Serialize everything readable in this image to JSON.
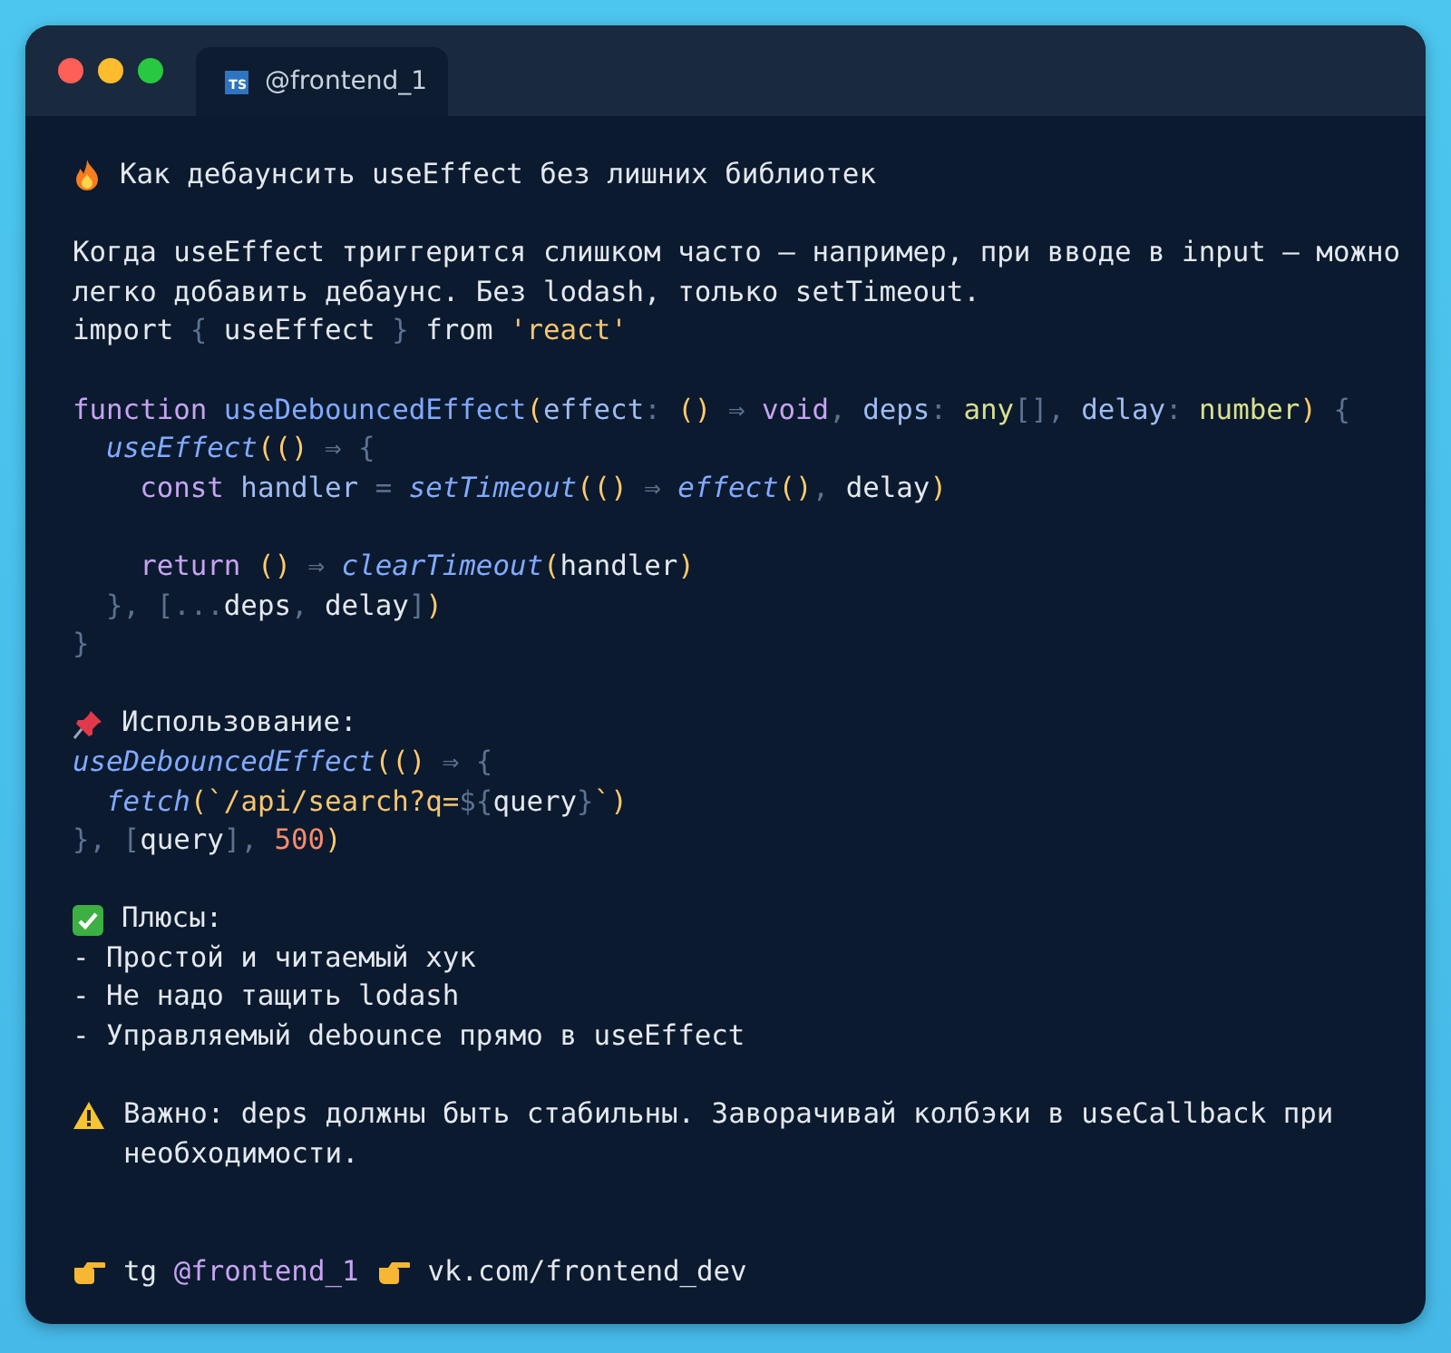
{
  "window": {
    "tab": {
      "badge": "TS",
      "label": "@frontend_1",
      "selected": true
    }
  },
  "lines": [
    {
      "kind": "title",
      "text": "Как дебаунсить useEffect без лишних библиотек"
    },
    {
      "kind": "blank"
    },
    {
      "kind": "text",
      "text": "Когда useEffect триггерится слишком часто — например, при вводе в input — можно легко добавить дебаунс. Без lodash, только setTimeout."
    },
    {
      "kind": "code",
      "tokens": [
        {
          "text": "import ",
          "kind": "plain"
        },
        {
          "text": "{",
          "kind": "punct"
        },
        {
          "text": " useEffect ",
          "kind": "plain"
        },
        {
          "text": "}",
          "kind": "punct"
        },
        {
          "text": " from ",
          "kind": "plain"
        },
        {
          "text": "'react'",
          "kind": "string"
        }
      ]
    },
    {
      "kind": "blank"
    },
    {
      "kind": "code",
      "tokens": [
        {
          "text": "function ",
          "kind": "keyword"
        },
        {
          "text": "useDebouncedEffect",
          "kind": "func"
        },
        {
          "text": "(",
          "kind": "paren"
        },
        {
          "text": "effect",
          "kind": "param"
        },
        {
          "text": ": ",
          "kind": "punct"
        },
        {
          "text": "()",
          "kind": "paren"
        },
        {
          "text": " ⇒ ",
          "kind": "punct"
        },
        {
          "text": "void",
          "kind": "keyword"
        },
        {
          "text": ", ",
          "kind": "punct"
        },
        {
          "text": "deps",
          "kind": "param"
        },
        {
          "text": ": ",
          "kind": "punct"
        },
        {
          "text": "any",
          "kind": "type"
        },
        {
          "text": "[], ",
          "kind": "punct"
        },
        {
          "text": "delay",
          "kind": "param"
        },
        {
          "text": ": ",
          "kind": "punct"
        },
        {
          "text": "number",
          "kind": "type"
        },
        {
          "text": ")",
          "kind": "paren"
        },
        {
          "text": " {",
          "kind": "punct"
        }
      ]
    },
    {
      "kind": "code",
      "tokens": [
        {
          "text": "  useEffect",
          "kind": "call"
        },
        {
          "text": "(()",
          "kind": "paren"
        },
        {
          "text": " ⇒ {",
          "kind": "punct"
        }
      ]
    },
    {
      "kind": "code",
      "tokens": [
        {
          "text": "    const",
          "kind": "keyword"
        },
        {
          "text": " handler",
          "kind": "param"
        },
        {
          "text": " = ",
          "kind": "punct"
        },
        {
          "text": "setTimeout",
          "kind": "call"
        },
        {
          "text": "(()",
          "kind": "paren"
        },
        {
          "text": " ⇒ ",
          "kind": "punct"
        },
        {
          "text": "effect",
          "kind": "call"
        },
        {
          "text": "()",
          "kind": "paren"
        },
        {
          "text": ", ",
          "kind": "punct"
        },
        {
          "text": "delay",
          "kind": "plain"
        },
        {
          "text": ")",
          "kind": "paren"
        }
      ]
    },
    {
      "kind": "blank"
    },
    {
      "kind": "code",
      "tokens": [
        {
          "text": "    return ",
          "kind": "keyword"
        },
        {
          "text": "()",
          "kind": "paren"
        },
        {
          "text": " ⇒ ",
          "kind": "punct"
        },
        {
          "text": "clearTimeout",
          "kind": "call"
        },
        {
          "text": "(",
          "kind": "paren"
        },
        {
          "text": "handler",
          "kind": "plain"
        },
        {
          "text": ")",
          "kind": "paren"
        }
      ]
    },
    {
      "kind": "code",
      "tokens": [
        {
          "text": "  }, [...",
          "kind": "punct"
        },
        {
          "text": "deps",
          "kind": "plain"
        },
        {
          "text": ", ",
          "kind": "punct"
        },
        {
          "text": "delay",
          "kind": "plain"
        },
        {
          "text": "]",
          "kind": "punct"
        },
        {
          "text": ")",
          "kind": "paren"
        }
      ]
    },
    {
      "kind": "code",
      "tokens": [
        {
          "text": "}",
          "kind": "punct"
        }
      ]
    },
    {
      "kind": "blank"
    },
    {
      "kind": "usage",
      "text": "Использование:"
    },
    {
      "kind": "code",
      "tokens": [
        {
          "text": "useDebouncedEffect",
          "kind": "call"
        },
        {
          "text": "(()",
          "kind": "paren"
        },
        {
          "text": " ⇒ {",
          "kind": "punct"
        }
      ]
    },
    {
      "kind": "code",
      "tokens": [
        {
          "text": "  fetch",
          "kind": "call"
        },
        {
          "text": "(",
          "kind": "paren"
        },
        {
          "text": "`/api/search?q=",
          "kind": "string"
        },
        {
          "text": "${",
          "kind": "punct"
        },
        {
          "text": "query",
          "kind": "plain"
        },
        {
          "text": "}",
          "kind": "punct"
        },
        {
          "text": "`",
          "kind": "string"
        },
        {
          "text": ")",
          "kind": "paren"
        }
      ]
    },
    {
      "kind": "code",
      "tokens": [
        {
          "text": "}, [",
          "kind": "punct"
        },
        {
          "text": "query",
          "kind": "plain"
        },
        {
          "text": "], ",
          "kind": "punct"
        },
        {
          "text": "500",
          "kind": "number"
        },
        {
          "text": ")",
          "kind": "paren"
        }
      ]
    },
    {
      "kind": "blank"
    },
    {
      "kind": "pros",
      "text": "Плюсы:"
    },
    {
      "kind": "item",
      "text": "- Простой и читаемый хук"
    },
    {
      "kind": "item",
      "text": "- Не надо тащить lodash"
    },
    {
      "kind": "item",
      "text": "- Управляемый debounce прямо в useEffect"
    },
    {
      "kind": "blank"
    },
    {
      "kind": "warning",
      "text": "Важно: deps должны быть стабильны. Заворачивай колбэки в useCallback при необходимости."
    },
    {
      "kind": "blank"
    },
    {
      "kind": "blank"
    },
    {
      "kind": "footer",
      "links": [
        {
          "prefix": "tg",
          "handle": "@frontend_1"
        },
        {
          "handle": "vk.com/frontend_dev"
        }
      ]
    }
  ]
}
